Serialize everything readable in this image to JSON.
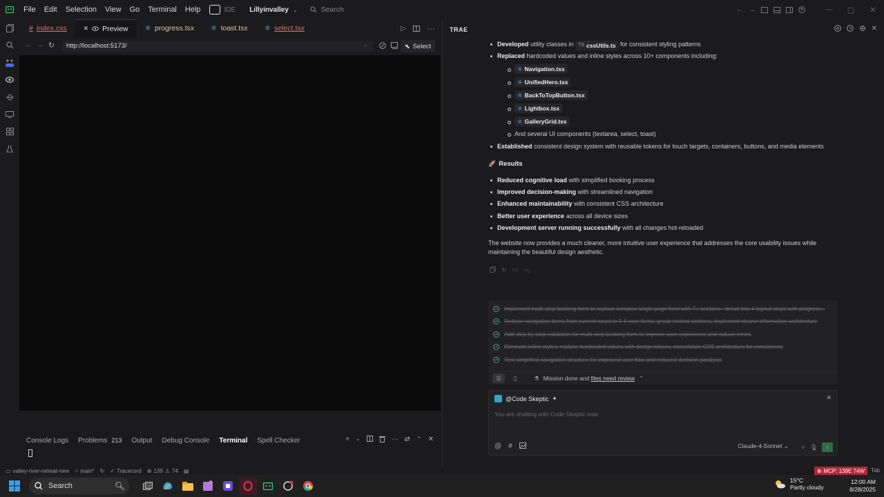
{
  "menu": [
    "File",
    "Edit",
    "Selection",
    "View",
    "Go",
    "Terminal",
    "Help"
  ],
  "ide_label": "IDE",
  "project": "Lillyinvalley",
  "search_placeholder": "Search",
  "tabs": [
    {
      "name": "index.css",
      "prefix": "#"
    },
    {
      "name": "Preview"
    },
    {
      "name": "progress.tsx"
    },
    {
      "name": "toast.tsx"
    },
    {
      "name": "select.tsx"
    }
  ],
  "url": "http://localhost:5173/",
  "select_label": "Select",
  "panel": {
    "tabs": [
      "Console Logs",
      "Problems",
      "Output",
      "Debug Console",
      "Terminal",
      "Spell Checker"
    ],
    "problems_count": "213"
  },
  "status": {
    "folder": "valley-river-retreat-new",
    "branch": "main*",
    "tracecord": "Tracecord",
    "errors": "139",
    "warnings": "74",
    "mcp": "MCP: 139E 74W",
    "tab": "Tab"
  },
  "chat": {
    "title": "TRAE",
    "lines": {
      "l1_bold": "Developed",
      "l1_a": " utility classes in ",
      "l1_chip_ts": "TS",
      "l1_chip": "cssUtils.ts",
      "l1_b": " for consistent styling patterns",
      "l2_bold": "Replaced",
      "l2_rest": " hardcoded values and inline styles across 10+ components including:",
      "files": [
        "Navigation.tsx",
        "UnifiedHero.tsx",
        "BackToTopButton.tsx",
        "Lightbox.tsx",
        "GalleryGrid.tsx"
      ],
      "ui_components": "And several UI components (textarea, select, toast)",
      "l3_bold": "Established",
      "l3_rest": " consistent design system with reusable tokens for touch targets, containers, buttons, and media elements"
    },
    "results_heading": "Results",
    "results": [
      {
        "bold": "Reduced cognitive load",
        "rest": " with simplified booking process"
      },
      {
        "bold": "Improved decision-making",
        "rest": " with streamlined navigation"
      },
      {
        "bold": "Enhanced maintainability",
        "rest": " with consistent CSS architecture"
      },
      {
        "bold": "Better user experience",
        "rest": " across all device sizes"
      },
      {
        "bold": "Development server running successfully",
        "rest": " with all changes hot-reloaded"
      }
    ],
    "summary": "The website now provides a much cleaner, more intuitive user experience that addresses the core usability issues while maintaining the beautiful design aesthetic.",
    "todos": [
      "Implement multi-step booking form to replace complex single-page form with 7+ sections - break into 4 logical steps with progress...",
      "Reduce navigation items from current count to 5-6 core items, group related sections, implement clearer information architecture",
      "Add step-by-step validation for multi-step booking form to improve user experience and reduce errors",
      "Eliminate inline styles, replace hardcoded values with design tokens, consolidate CSS architecture for consistency",
      "Test simplified navigation structure for improved user flow and reduced decision paralysis"
    ],
    "mission_a": "Mission done and ",
    "mission_link": "files need review",
    "agent": "@Code Skeptic",
    "input_placeholder": "You are chatting with Code Skeptic now",
    "model": "Claude-4-Sonnet"
  },
  "taskbar": {
    "search": "Search",
    "temp": "15°C",
    "weather": "Partly cloudy",
    "time": "12:00 AM",
    "date": "8/28/2025"
  }
}
